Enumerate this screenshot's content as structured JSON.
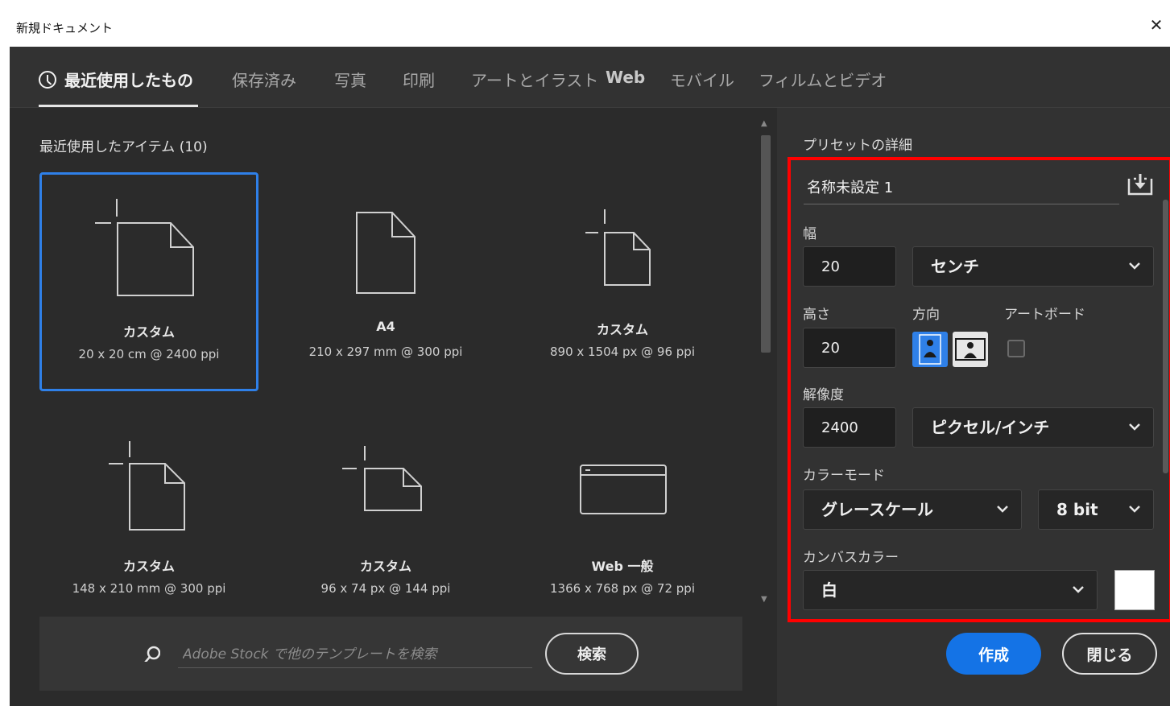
{
  "window": {
    "title": "新規ドキュメント",
    "close_icon": "close-icon"
  },
  "tabs": [
    {
      "label": "最近使用したもの",
      "active": true,
      "icon": "clock-icon"
    },
    {
      "label": "保存済み"
    },
    {
      "label": "写真"
    },
    {
      "label": "印刷"
    },
    {
      "label": "アートとイラスト"
    },
    {
      "label": "Web"
    },
    {
      "label": "モバイル"
    },
    {
      "label": "フィルムとビデオ"
    }
  ],
  "recent": {
    "title": "最近使用したアイテム (10)",
    "items": [
      {
        "name": "カスタム",
        "desc": "20 x 20 cm @ 2400 ppi",
        "icon": "custom-document-icon",
        "selected": true
      },
      {
        "name": "A4",
        "desc": "210 x 297 mm @ 300 ppi",
        "icon": "document-icon"
      },
      {
        "name": "カスタム",
        "desc": "890 x 1504 px @ 96 ppi",
        "icon": "custom-document-icon"
      },
      {
        "name": "カスタム",
        "desc": "148 x 210 mm @ 300 ppi",
        "icon": "custom-document-icon"
      },
      {
        "name": "カスタム",
        "desc": "96 x 74 px @ 144 ppi",
        "icon": "custom-document-icon"
      },
      {
        "name": "Web 一般",
        "desc": "1366 x 768 px @ 72 ppi",
        "icon": "web-browser-icon"
      }
    ]
  },
  "search": {
    "placeholder": "Adobe Stock で他のテンプレートを検索",
    "button": "検索",
    "icon": "search-icon"
  },
  "preset_details": {
    "title": "プリセットの詳細",
    "name": "名称未設定 1",
    "save_icon": "save-preset-icon",
    "width_label": "幅",
    "width": "20",
    "unit": "センチ",
    "height_label": "高さ",
    "height": "20",
    "orientation_label": "方向",
    "orientation": "portrait",
    "artboard_label": "アートボード",
    "artboard_checked": false,
    "resolution_label": "解像度",
    "resolution": "2400",
    "resolution_unit": "ピクセル/インチ",
    "color_mode_label": "カラーモード",
    "color_mode": "グレースケール",
    "bit_depth": "8 bit",
    "canvas_color_label": "カンバスカラー",
    "canvas_color": "白",
    "canvas_swatch": "#ffffff"
  },
  "actions": {
    "create": "作成",
    "close": "閉じる"
  },
  "colors": {
    "accent": "#1473e6",
    "highlight": "#ff0000",
    "selected_border": "#2f80e8"
  }
}
